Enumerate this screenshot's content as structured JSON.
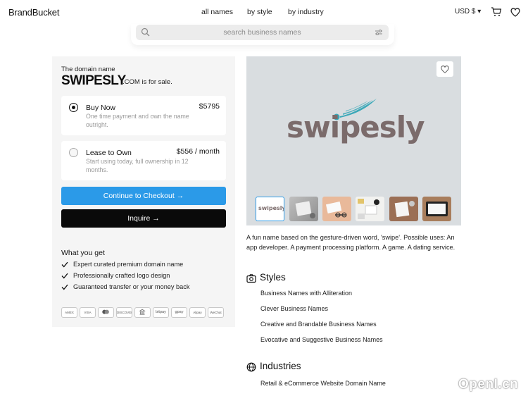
{
  "header": {
    "logo": "BrandBucket",
    "nav": [
      "all names",
      "by style",
      "by industry"
    ],
    "currency": "USD $ ▾"
  },
  "search": {
    "placeholder": "search business names"
  },
  "listing": {
    "label": "The domain name",
    "name": "SWIPESLY",
    "tld_text": ".COM is for sale.",
    "options": [
      {
        "title": "Buy Now",
        "price": "$5795",
        "desc": "One time payment and own the name outright.",
        "selected": true
      },
      {
        "title": "Lease to Own",
        "price": "$556 / month",
        "desc": "Start using today, full ownership in 12 months.",
        "selected": false
      }
    ],
    "checkout_label": "Continue to Checkout →",
    "inquire_label": "Inquire →",
    "what_you_get_title": "What you get",
    "benefits": [
      "Expert curated premium domain name",
      "Professionally crafted logo design",
      "Guaranteed transfer or your money back"
    ],
    "payment_methods": [
      "AMEX",
      "VISA",
      "MC",
      "DISCOVER",
      "BANK",
      "bitpay",
      "gpay",
      "Alipay",
      "WeChat"
    ]
  },
  "hero": {
    "logo_word": "swipesly",
    "thumb_word": "swipesly",
    "accent_color": "#3aa8b8",
    "word_color": "#7b6b6b"
  },
  "description": "A fun name based on the gesture-driven word, 'swipe'. Possible uses: An app developer. A payment processing platform. A game. A dating service.",
  "styles": {
    "title": "Styles",
    "items": [
      "Business Names with Alliteration",
      "Clever Business Names",
      "Creative and Brandable Business Names",
      "Evocative and Suggestive Business Names"
    ]
  },
  "industries": {
    "title": "Industries",
    "items": [
      "Retail & eCommerce Website Domain Name"
    ]
  },
  "watermark": "OpenI.cn"
}
